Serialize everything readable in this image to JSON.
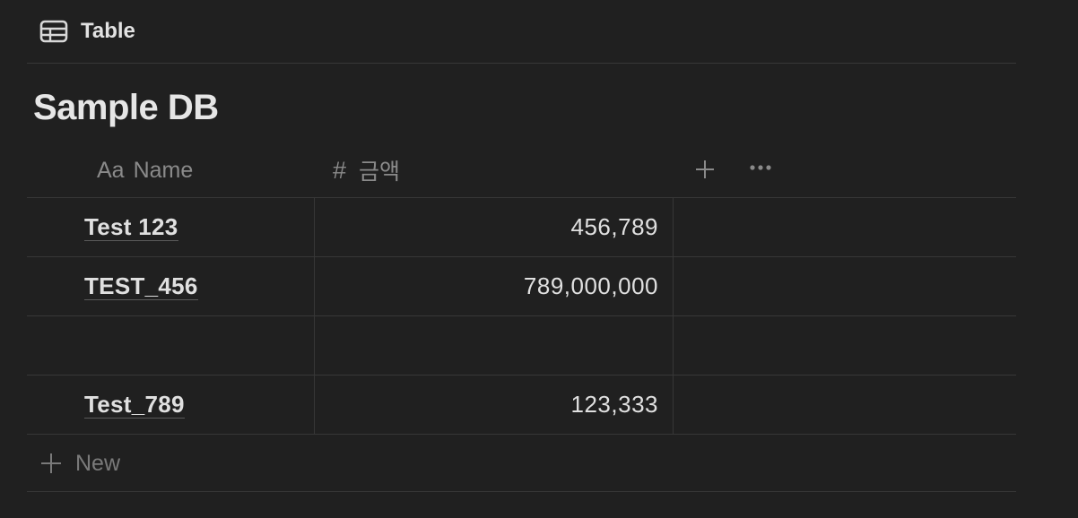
{
  "view": {
    "icon": "table-icon",
    "label": "Table"
  },
  "database": {
    "title": "Sample DB"
  },
  "columns": [
    {
      "icon": "text-property-icon",
      "icon_text": "Aa",
      "label": "Name"
    },
    {
      "icon": "number-property-icon",
      "icon_text": "#",
      "label": "금액"
    }
  ],
  "column_actions": {
    "add": "plus-icon",
    "more": "more-horizontal-icon"
  },
  "rows": [
    {
      "name": "Test 123",
      "amount": "456,789"
    },
    {
      "name": "TEST_456",
      "amount": "789,000,000"
    },
    {
      "name": "",
      "amount": ""
    },
    {
      "name": "Test_789",
      "amount": "123,333"
    }
  ],
  "new_row": {
    "icon": "plus-icon",
    "label": "New"
  },
  "colors": {
    "background": "#202020",
    "border": "#373737",
    "text": "#e0e0e0",
    "muted": "#8a8a8a"
  }
}
